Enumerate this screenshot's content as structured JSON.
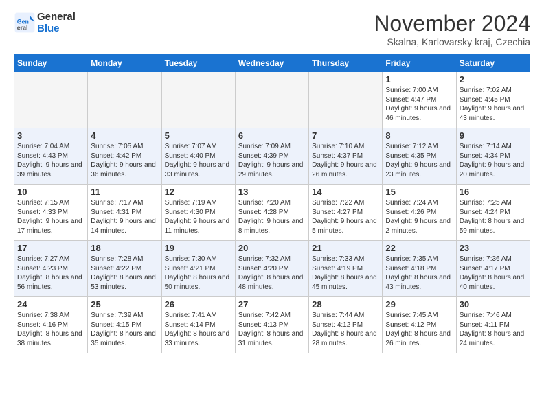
{
  "logo": {
    "line1": "General",
    "line2": "Blue"
  },
  "header": {
    "month": "November 2024",
    "location": "Skalna, Karlovarsky kraj, Czechia"
  },
  "weekdays": [
    "Sunday",
    "Monday",
    "Tuesday",
    "Wednesday",
    "Thursday",
    "Friday",
    "Saturday"
  ],
  "weeks": [
    [
      {
        "day": "",
        "empty": true
      },
      {
        "day": "",
        "empty": true
      },
      {
        "day": "",
        "empty": true
      },
      {
        "day": "",
        "empty": true
      },
      {
        "day": "",
        "empty": true
      },
      {
        "day": "1",
        "sunrise": "7:00 AM",
        "sunset": "4:47 PM",
        "daylight": "9 hours and 46 minutes."
      },
      {
        "day": "2",
        "sunrise": "7:02 AM",
        "sunset": "4:45 PM",
        "daylight": "9 hours and 43 minutes."
      }
    ],
    [
      {
        "day": "3",
        "sunrise": "7:04 AM",
        "sunset": "4:43 PM",
        "daylight": "9 hours and 39 minutes."
      },
      {
        "day": "4",
        "sunrise": "7:05 AM",
        "sunset": "4:42 PM",
        "daylight": "9 hours and 36 minutes."
      },
      {
        "day": "5",
        "sunrise": "7:07 AM",
        "sunset": "4:40 PM",
        "daylight": "9 hours and 33 minutes."
      },
      {
        "day": "6",
        "sunrise": "7:09 AM",
        "sunset": "4:39 PM",
        "daylight": "9 hours and 29 minutes."
      },
      {
        "day": "7",
        "sunrise": "7:10 AM",
        "sunset": "4:37 PM",
        "daylight": "9 hours and 26 minutes."
      },
      {
        "day": "8",
        "sunrise": "7:12 AM",
        "sunset": "4:35 PM",
        "daylight": "9 hours and 23 minutes."
      },
      {
        "day": "9",
        "sunrise": "7:14 AM",
        "sunset": "4:34 PM",
        "daylight": "9 hours and 20 minutes."
      }
    ],
    [
      {
        "day": "10",
        "sunrise": "7:15 AM",
        "sunset": "4:33 PM",
        "daylight": "9 hours and 17 minutes."
      },
      {
        "day": "11",
        "sunrise": "7:17 AM",
        "sunset": "4:31 PM",
        "daylight": "9 hours and 14 minutes."
      },
      {
        "day": "12",
        "sunrise": "7:19 AM",
        "sunset": "4:30 PM",
        "daylight": "9 hours and 11 minutes."
      },
      {
        "day": "13",
        "sunrise": "7:20 AM",
        "sunset": "4:28 PM",
        "daylight": "9 hours and 8 minutes."
      },
      {
        "day": "14",
        "sunrise": "7:22 AM",
        "sunset": "4:27 PM",
        "daylight": "9 hours and 5 minutes."
      },
      {
        "day": "15",
        "sunrise": "7:24 AM",
        "sunset": "4:26 PM",
        "daylight": "9 hours and 2 minutes."
      },
      {
        "day": "16",
        "sunrise": "7:25 AM",
        "sunset": "4:24 PM",
        "daylight": "8 hours and 59 minutes."
      }
    ],
    [
      {
        "day": "17",
        "sunrise": "7:27 AM",
        "sunset": "4:23 PM",
        "daylight": "8 hours and 56 minutes."
      },
      {
        "day": "18",
        "sunrise": "7:28 AM",
        "sunset": "4:22 PM",
        "daylight": "8 hours and 53 minutes."
      },
      {
        "day": "19",
        "sunrise": "7:30 AM",
        "sunset": "4:21 PM",
        "daylight": "8 hours and 50 minutes."
      },
      {
        "day": "20",
        "sunrise": "7:32 AM",
        "sunset": "4:20 PM",
        "daylight": "8 hours and 48 minutes."
      },
      {
        "day": "21",
        "sunrise": "7:33 AM",
        "sunset": "4:19 PM",
        "daylight": "8 hours and 45 minutes."
      },
      {
        "day": "22",
        "sunrise": "7:35 AM",
        "sunset": "4:18 PM",
        "daylight": "8 hours and 43 minutes."
      },
      {
        "day": "23",
        "sunrise": "7:36 AM",
        "sunset": "4:17 PM",
        "daylight": "8 hours and 40 minutes."
      }
    ],
    [
      {
        "day": "24",
        "sunrise": "7:38 AM",
        "sunset": "4:16 PM",
        "daylight": "8 hours and 38 minutes."
      },
      {
        "day": "25",
        "sunrise": "7:39 AM",
        "sunset": "4:15 PM",
        "daylight": "8 hours and 35 minutes."
      },
      {
        "day": "26",
        "sunrise": "7:41 AM",
        "sunset": "4:14 PM",
        "daylight": "8 hours and 33 minutes."
      },
      {
        "day": "27",
        "sunrise": "7:42 AM",
        "sunset": "4:13 PM",
        "daylight": "8 hours and 31 minutes."
      },
      {
        "day": "28",
        "sunrise": "7:44 AM",
        "sunset": "4:12 PM",
        "daylight": "8 hours and 28 minutes."
      },
      {
        "day": "29",
        "sunrise": "7:45 AM",
        "sunset": "4:12 PM",
        "daylight": "8 hours and 26 minutes."
      },
      {
        "day": "30",
        "sunrise": "7:46 AM",
        "sunset": "4:11 PM",
        "daylight": "8 hours and 24 minutes."
      }
    ]
  ]
}
